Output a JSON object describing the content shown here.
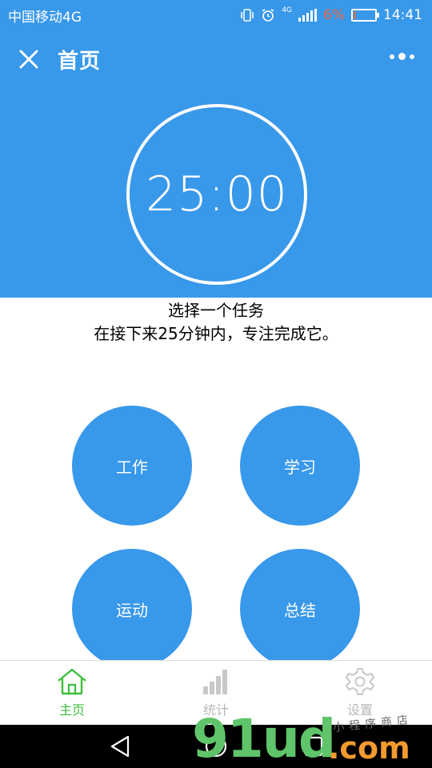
{
  "status_bar": {
    "carrier": "中国移动4G",
    "network_badge": "4G",
    "battery_percent": "6%",
    "battery_level": 0.06,
    "time": "14:41",
    "icons": [
      "vibrate-icon",
      "alarm-icon",
      "signal-icon",
      "battery-icon"
    ]
  },
  "nav": {
    "title": "首页",
    "icons": [
      "close-icon",
      "more-icon"
    ]
  },
  "timer": {
    "value": "25:00"
  },
  "instructions": {
    "line1": "选择一个任务",
    "line2": "在接下来25分钟内，专注完成它。"
  },
  "tasks": [
    {
      "label": "工作"
    },
    {
      "label": "学习"
    },
    {
      "label": "运动"
    },
    {
      "label": "总结"
    }
  ],
  "tabs": [
    {
      "label": "主页",
      "icon": "home-icon",
      "active": true
    },
    {
      "label": "统计",
      "icon": "stats-icon",
      "active": false
    },
    {
      "label": "设置",
      "icon": "gear-icon",
      "active": false
    }
  ],
  "colors": {
    "primary": "#3898ea",
    "tab_active": "#3dbd3d",
    "tab_inactive": "#b8b8b8",
    "battery_low": "#f06a3a"
  },
  "watermark": {
    "main": "91ud",
    "suffix": ".com",
    "tagline": "小程序商店"
  }
}
